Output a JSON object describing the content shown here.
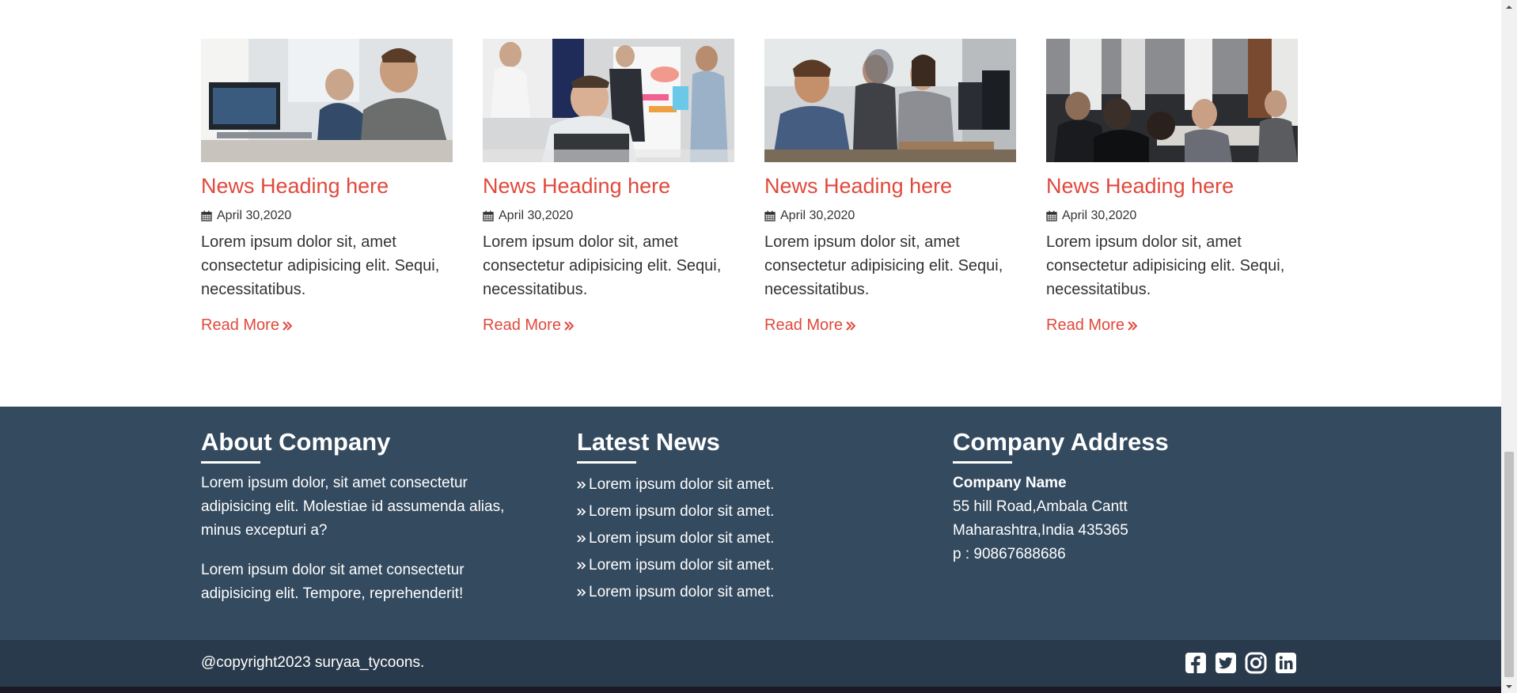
{
  "news": {
    "cards": [
      {
        "title": "News Heading here",
        "date": "April 30,2020",
        "text": "Lorem ipsum dolor sit, amet consectetur adipisicing elit. Sequi, necessitatibus.",
        "link": "Read More"
      },
      {
        "title": "News Heading here",
        "date": "April 30,2020",
        "text": "Lorem ipsum dolor sit, amet consectetur adipisicing elit. Sequi, necessitatibus.",
        "link": "Read More"
      },
      {
        "title": "News Heading here",
        "date": "April 30,2020",
        "text": "Lorem ipsum dolor sit, amet consectetur adipisicing elit. Sequi, necessitatibus.",
        "link": "Read More"
      },
      {
        "title": "News Heading here",
        "date": "April 30,2020",
        "text": "Lorem ipsum dolor sit, amet consectetur adipisicing elit. Sequi, necessitatibus.",
        "link": "Read More"
      }
    ]
  },
  "footer": {
    "about": {
      "heading": "About Company",
      "para1": "Lorem ipsum dolor, sit amet consectetur adipisicing elit. Molestiae id assumenda alias, minus excepturi a?",
      "para2": "Lorem ipsum dolor sit amet consectetur adipisicing elit. Tempore, reprehenderit!"
    },
    "latest": {
      "heading": "Latest News",
      "items": [
        "Lorem ipsum dolor sit amet.",
        "Lorem ipsum dolor sit amet.",
        "Lorem ipsum dolor sit amet.",
        "Lorem ipsum dolor sit amet.",
        "Lorem ipsum dolor sit amet."
      ]
    },
    "address": {
      "heading": "Company Address",
      "company_name": "Company Name",
      "line1": "55 hill Road,Ambala Cantt",
      "line2": "Maharashtra,India 435365",
      "phone": "p : 90867688686"
    }
  },
  "bottom": {
    "copyright": "@copyright2023 suryaa_tycoons.",
    "social": [
      "facebook-icon",
      "twitter-icon",
      "instagram-icon",
      "linkedin-icon"
    ]
  },
  "colors": {
    "accent": "#e0493c",
    "footer_bg": "#344a5f",
    "bottom_bg": "#283a4b"
  }
}
